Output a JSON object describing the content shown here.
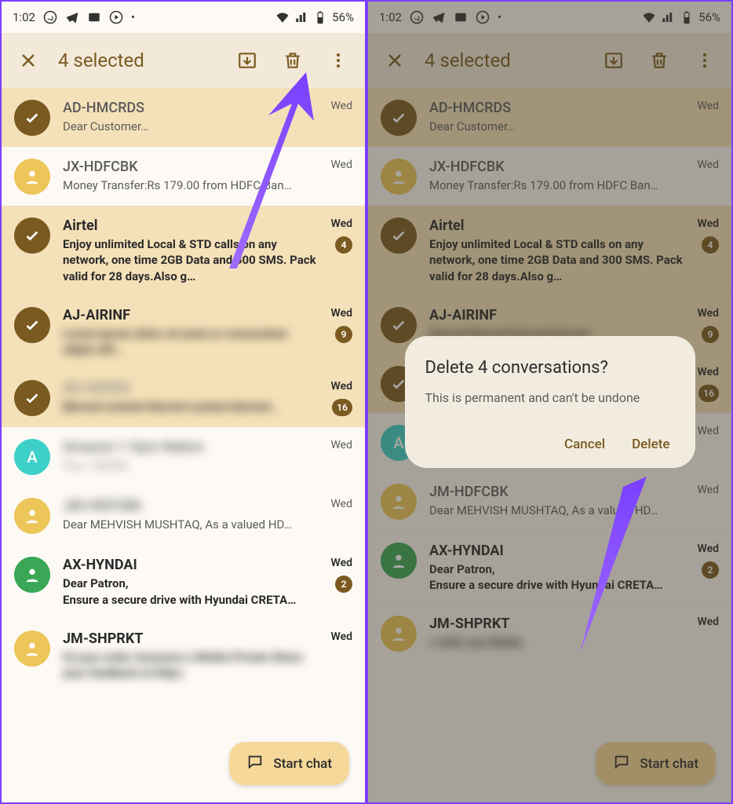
{
  "status": {
    "time": "1:02",
    "battery": "56%"
  },
  "selection": {
    "close": "✕",
    "title": "4 selected"
  },
  "rows": [
    {
      "sender": "AD-HMCRDS",
      "preview": "Dear Customer…",
      "time": "Wed",
      "selected": true,
      "bold": false,
      "avatar": "check"
    },
    {
      "sender": "JX-HDFCBK",
      "preview": "Money Transfer:Rs 179.00 from HDFC Ban…",
      "time": "Wed",
      "selected": false,
      "bold": false,
      "avatar": "yellow"
    },
    {
      "sender": "Airtel",
      "preview": "Enjoy unlimited Local & STD calls on any network, one time 2GB Data and 300 SMS. Pack valid for 28 days.Also g…",
      "time": "Wed",
      "selected": true,
      "bold": true,
      "avatar": "check",
      "badge": "4"
    },
    {
      "sender": "AJ-AIRINF",
      "preview": "",
      "time": "Wed",
      "selected": true,
      "bold": true,
      "avatar": "check",
      "badge": "9",
      "blur": true
    },
    {
      "sender": "",
      "preview": "",
      "time": "Wed",
      "selected": true,
      "bold": true,
      "avatar": "check",
      "badge": "16",
      "blur": true
    },
    {
      "sender_left": "",
      "preview_left": "",
      "sender_right": "Amazon 1 Gym Nation",
      "preview_right": "You: 144342",
      "time": "Wed",
      "avatar": "teal",
      "avatarText": "A",
      "read": true,
      "blur_left_only": true
    },
    {
      "sender_left": "",
      "preview_left": "Dear MEHVISH MUSHTAQ, As a valued HD…",
      "sender_right": "JM-HDFCBK",
      "preview_right": "Dear MEHVISH MUSHTAQ, As a valued HD…",
      "time": "Wed",
      "avatar": "yellow",
      "read": true,
      "blur_sender_left": true
    },
    {
      "sender": "AX-HYNDAI",
      "preview": "Dear Patron,\nEnsure a secure drive with Hyundai CRETA…",
      "time": "Wed",
      "avatar": "green",
      "bold": true,
      "badge": "2"
    },
    {
      "sender": "JM-SHPRKT",
      "preview_left": "",
      "time": "Wed",
      "avatar": "yellow",
      "bold": true,
      "blur_preview": true
    }
  ],
  "fab": "Start chat",
  "dialog": {
    "title": "Delete 4 conversations?",
    "message": "This is permanent and can't be undone",
    "cancel": "Cancel",
    "confirm": "Delete"
  }
}
